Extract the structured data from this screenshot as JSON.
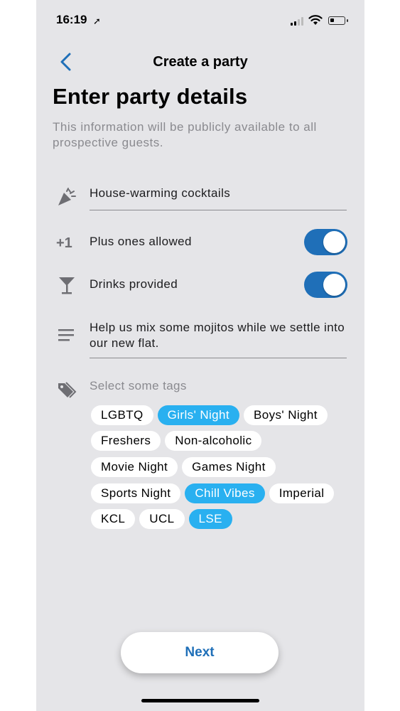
{
  "status_bar": {
    "time": "16:19",
    "location_glyph": "➚"
  },
  "nav": {
    "title": "Create a party",
    "back_icon": "chevron-left-icon"
  },
  "header": {
    "title": "Enter party details",
    "subtitle": "This information will be publicly available to all prospective guests."
  },
  "form": {
    "party_name": {
      "icon": "party-popper-icon",
      "value": "House-warming cocktails"
    },
    "plus_ones": {
      "icon_text": "+1",
      "label": "Plus ones allowed",
      "enabled": true
    },
    "drinks": {
      "icon": "cocktail-glass-icon",
      "label": "Drinks provided",
      "enabled": true
    },
    "description": {
      "icon": "text-lines-icon",
      "value": "Help us mix some mojitos while we settle into our new flat."
    },
    "tags_label": "Select some tags"
  },
  "tags": {
    "row1": [
      {
        "label": "LGBTQ",
        "selected": false
      },
      {
        "label": "Girls' Night",
        "selected": true
      },
      {
        "label": "Boys' Night",
        "selected": false
      }
    ],
    "row2": [
      {
        "label": "Freshers",
        "selected": false
      },
      {
        "label": "Non-alcoholic",
        "selected": false
      }
    ],
    "row3": [
      {
        "label": "Movie Night",
        "selected": false
      },
      {
        "label": "Games Night",
        "selected": false
      }
    ],
    "row4": [
      {
        "label": "Sports Night",
        "selected": false
      },
      {
        "label": "Chill Vibes",
        "selected": true
      },
      {
        "label": "Imperial",
        "selected": false
      }
    ],
    "row5": [
      {
        "label": "KCL",
        "selected": false
      },
      {
        "label": "UCL",
        "selected": false
      },
      {
        "label": "LSE",
        "selected": true
      }
    ]
  },
  "footer": {
    "next_label": "Next"
  },
  "colors": {
    "accent": "#1f6fb8",
    "tag_selected": "#29b0f0",
    "background": "#e5e5e8"
  }
}
